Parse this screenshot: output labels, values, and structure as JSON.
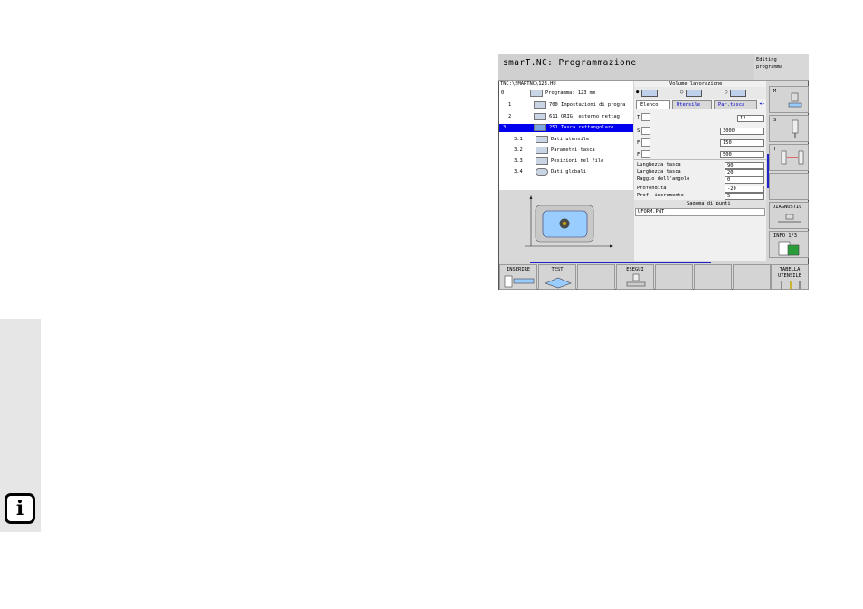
{
  "screen": {
    "title": "smarT.NC: Programmazione",
    "mode_line1": "Editing",
    "mode_line2": "programma"
  },
  "tree": {
    "path": "TNC:\\SMARTNC\\123.HU",
    "rows": [
      {
        "num": "0",
        "label": "Programma: 123 mm"
      },
      {
        "num": "1",
        "label": "700 Impostazioni di progra"
      },
      {
        "num": "2",
        "label": "611 ORIG. esterno rettag."
      },
      {
        "num": "3",
        "label": "251 Tasca rettangolare"
      },
      {
        "num": "3.1",
        "label": "Dati utensile"
      },
      {
        "num": "3.2",
        "label": "Parametri tasca"
      },
      {
        "num": "3.3",
        "label": "Posizioni nel file"
      },
      {
        "num": "3.4",
        "label": "Dati globali"
      }
    ]
  },
  "form": {
    "volume_title": "Volume lavorazione",
    "tabs": [
      "Elenco",
      "Utensile",
      "Par.tasca"
    ],
    "tool_T": "T",
    "tool_value": "12",
    "S_label": "S",
    "S_value": "3000",
    "F1_label": "F",
    "F1_value": "150",
    "F2_label": "F",
    "F2_value": "500",
    "params": [
      {
        "label": "Lunghezza tasca",
        "value": "90"
      },
      {
        "label": "Larghezza tasca",
        "value": "20"
      },
      {
        "label": "Raggio dell'angolo",
        "value": "0"
      },
      {
        "label": "Profondita",
        "value": "-20"
      },
      {
        "label": "Prof. incremento",
        "value": "5"
      }
    ],
    "pattern_title": "Sagoma di punti",
    "pattern_value": "UFORM.PNT"
  },
  "right_softkeys": [
    "M",
    "S",
    "T",
    "",
    "DIAGNOSTIC",
    "INFO 1/3"
  ],
  "bottom_softkeys": [
    {
      "line1": "INSERIRE",
      "line2": ""
    },
    {
      "line1": "TEST",
      "line2": ""
    },
    {
      "line1": "",
      "line2": ""
    },
    {
      "line1": "ESEGUI",
      "line2": ""
    },
    {
      "line1": "",
      "line2": ""
    },
    {
      "line1": "",
      "line2": ""
    },
    {
      "line1": "",
      "line2": ""
    },
    {
      "line1": "TABELLA",
      "line2": "UTENSILE"
    }
  ],
  "colors": {
    "selection": "#0000ee",
    "link": "#0000cc",
    "pocket": "#99ccff"
  },
  "margin_icon": "info-icon"
}
